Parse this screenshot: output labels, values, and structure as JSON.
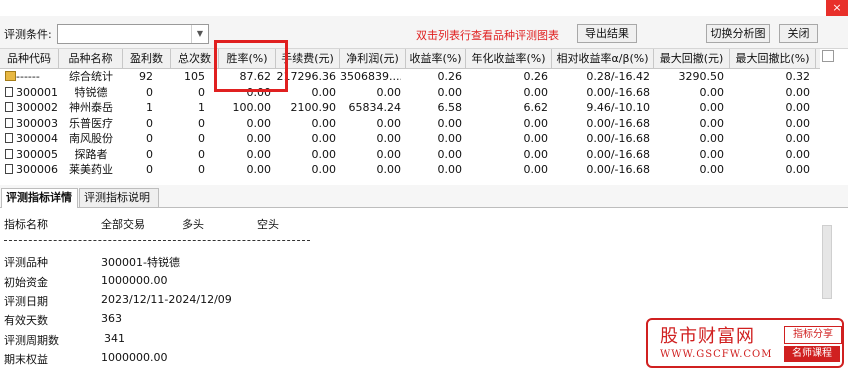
{
  "window": {
    "close_glyph": "×"
  },
  "toolbar": {
    "condition_label": "评测条件:",
    "condition_value": "",
    "hint": "双击列表行查看品种评测图表",
    "export_label": "导出结果",
    "switch_label": "切换分析图",
    "close_label": "关闭"
  },
  "grid": {
    "columns": [
      "品种代码",
      "品种名称",
      "盈利数",
      "总次数",
      "胜率(%)",
      "手续费(元)",
      "净利润(元)",
      "收益率(%)",
      "年化收益率(%)",
      "相对收益率α/β(%)",
      "最大回撤(元)",
      "最大回撤比(%)"
    ],
    "rows": [
      {
        "code": "------",
        "name": "综合统计",
        "wins": "92",
        "total": "105",
        "winrate": "87.62",
        "fee": "217296.36",
        "profit": "3506839....",
        "ret": "0.26",
        "annual": "0.26",
        "rel": "0.28/-16.42",
        "dd": "3290.50",
        "ddr": "0.32",
        "icon": "folder-icon"
      },
      {
        "code": "300001",
        "name": "特锐德",
        "wins": "0",
        "total": "0",
        "winrate": "0.00",
        "fee": "0.00",
        "profit": "0.00",
        "ret": "0.00",
        "annual": "0.00",
        "rel": "0.00/-16.68",
        "dd": "0.00",
        "ddr": "0.00",
        "icon": "file-icon"
      },
      {
        "code": "300002",
        "name": "神州泰岳",
        "wins": "1",
        "total": "1",
        "winrate": "100.00",
        "fee": "2100.90",
        "profit": "65834.24",
        "ret": "6.58",
        "annual": "6.62",
        "rel": "9.46/-10.10",
        "dd": "0.00",
        "ddr": "0.00",
        "icon": "file-icon"
      },
      {
        "code": "300003",
        "name": "乐普医疗",
        "wins": "0",
        "total": "0",
        "winrate": "0.00",
        "fee": "0.00",
        "profit": "0.00",
        "ret": "0.00",
        "annual": "0.00",
        "rel": "0.00/-16.68",
        "dd": "0.00",
        "ddr": "0.00",
        "icon": "file-icon"
      },
      {
        "code": "300004",
        "name": "南风股份",
        "wins": "0",
        "total": "0",
        "winrate": "0.00",
        "fee": "0.00",
        "profit": "0.00",
        "ret": "0.00",
        "annual": "0.00",
        "rel": "0.00/-16.68",
        "dd": "0.00",
        "ddr": "0.00",
        "icon": "file-icon"
      },
      {
        "code": "300005",
        "name": "探路者",
        "wins": "0",
        "total": "0",
        "winrate": "0.00",
        "fee": "0.00",
        "profit": "0.00",
        "ret": "0.00",
        "annual": "0.00",
        "rel": "0.00/-16.68",
        "dd": "0.00",
        "ddr": "0.00",
        "icon": "file-icon"
      },
      {
        "code": "300006",
        "name": "莱美药业",
        "wins": "0",
        "total": "0",
        "winrate": "0.00",
        "fee": "0.00",
        "profit": "0.00",
        "ret": "0.00",
        "annual": "0.00",
        "rel": "0.00/-16.68",
        "dd": "0.00",
        "ddr": "0.00",
        "icon": "file-icon"
      }
    ]
  },
  "tabs": [
    {
      "label": "评测指标详情",
      "active": true
    },
    {
      "label": "评测指标说明",
      "active": false
    }
  ],
  "detail": {
    "header": {
      "name": "指标名称",
      "all": "全部交易",
      "long": "多头",
      "short": "空头"
    },
    "lines": [
      {
        "label": "评测品种",
        "value": "300001-特锐德"
      },
      {
        "label": "初始资金",
        "value": "1000000.00"
      },
      {
        "label": "评测日期",
        "value": "2023/12/11-2024/12/09"
      },
      {
        "label": "有效天数",
        "value": "363"
      },
      {
        "label": "评测周期数",
        "value": "341"
      },
      {
        "label": "期末权益",
        "value": "1000000.00"
      }
    ]
  },
  "watermark": {
    "title": "股市财富网",
    "url": "WWW.GSCFW.COM",
    "tag1": "指标分享",
    "tag2": "名师课程"
  },
  "colors": {
    "accent_red": "#e02020",
    "header_bg": "#f1f1f1"
  }
}
